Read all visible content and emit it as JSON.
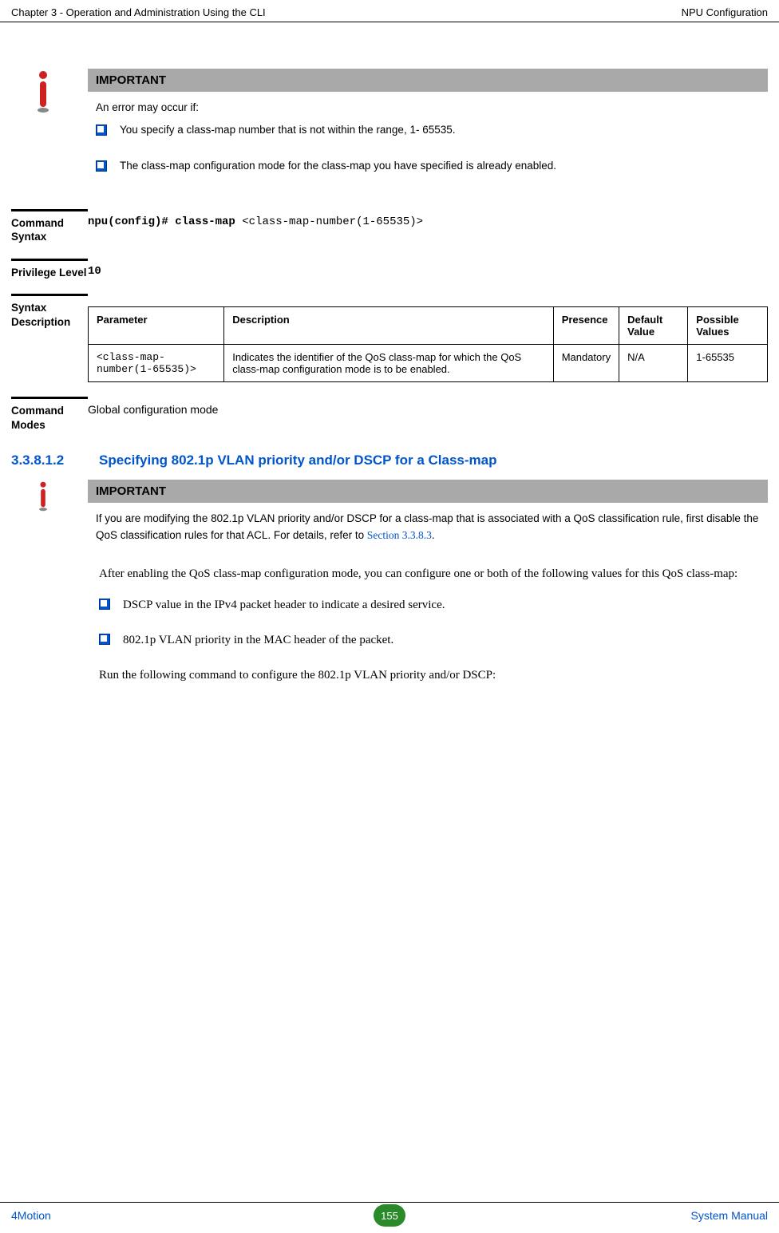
{
  "header": {
    "left": "Chapter 3 - Operation and Administration Using the CLI",
    "right": "NPU Configuration"
  },
  "important1": {
    "title": "IMPORTANT",
    "intro": "An error may occur if:",
    "bullets": [
      "You specify a class-map number that is not within the range, 1- 65535.",
      "The class-map configuration mode for the class-map you have specified is already enabled."
    ]
  },
  "command_syntax": {
    "label": "Command Syntax",
    "bold": "npu(config)# class-map",
    "rest": " <class-map-number(1-65535)>"
  },
  "privilege": {
    "label": "Privilege Level",
    "value": "10"
  },
  "syntax_desc": {
    "label": "Syntax Description",
    "headers": {
      "parameter": "Parameter",
      "description": "Description",
      "presence": "Presence",
      "default": "Default Value",
      "possible": "Possible Values"
    },
    "row": {
      "parameter": "<class-map-number(1-65535)>",
      "description": "Indicates the identifier of the QoS class-map for which the QoS class-map configuration mode is to be enabled.",
      "presence": "Mandatory",
      "default": "N/A",
      "possible": "1-65535"
    }
  },
  "command_modes": {
    "label": "Command Modes",
    "value": "Global configuration mode"
  },
  "section": {
    "number": "3.3.8.1.2",
    "title": "Specifying 802.1p VLAN priority and/or DSCP for a Class-map"
  },
  "important2": {
    "title": "IMPORTANT",
    "text_part1": "If you are modifying the 802.1p VLAN priority and/or DSCP for a class-map that is associated with a QoS classification rule, first disable the QoS classification rules for that ACL. For details, refer to ",
    "link": "Section 3.3.8.3",
    "text_part2": "."
  },
  "body1": "After enabling the QoS class-map configuration mode, you can configure one or both of the following values for this QoS class-map:",
  "body_bullets": [
    "DSCP value in the IPv4 packet header to indicate a desired service.",
    "802.1p VLAN priority in the MAC header of the packet."
  ],
  "body2": "Run the following command to configure the 802.1p VLAN priority and/or DSCP:",
  "footer": {
    "left": "4Motion",
    "page": "155",
    "right": "System Manual"
  }
}
